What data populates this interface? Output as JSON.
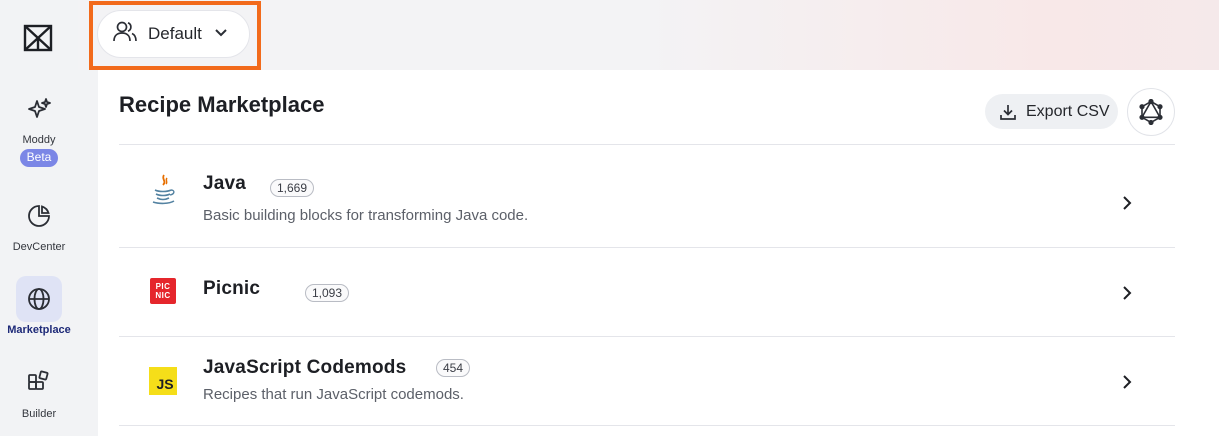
{
  "sidebar": {
    "logo_icon": "moderne-logo-icon",
    "items": [
      {
        "label": "Moddy",
        "badge": "Beta",
        "icon": "sparkles-icon"
      },
      {
        "label": "DevCenter",
        "icon": "pie-chart-icon"
      },
      {
        "label": "Marketplace",
        "icon": "globe-icon",
        "active": true
      },
      {
        "label": "Builder",
        "icon": "blocks-icon"
      }
    ]
  },
  "header": {
    "org_selector": {
      "label": "Default",
      "icon": "users-icon"
    }
  },
  "main": {
    "title": "Recipe Marketplace",
    "export_label": "Export CSV",
    "graphql_icon": "graphql-icon",
    "rows": [
      {
        "name": "Java",
        "count": "1,669",
        "description": "Basic building blocks for transforming Java code.",
        "icon": "java-icon"
      },
      {
        "name": "Picnic",
        "count": "1,093",
        "description": "",
        "icon": "picnic-icon",
        "icon_text": "PIC NIC"
      },
      {
        "name": "JavaScript Codemods",
        "count": "454",
        "description": "Recipes that run JavaScript codemods.",
        "icon": "javascript-icon",
        "icon_text": "JS"
      }
    ]
  },
  "colors": {
    "highlight": "#f26a1b",
    "beta_badge": "#7b86e6",
    "active_nav": "#dfe3f5",
    "picnic_red": "#e5262c",
    "js_yellow": "#f5de19"
  }
}
